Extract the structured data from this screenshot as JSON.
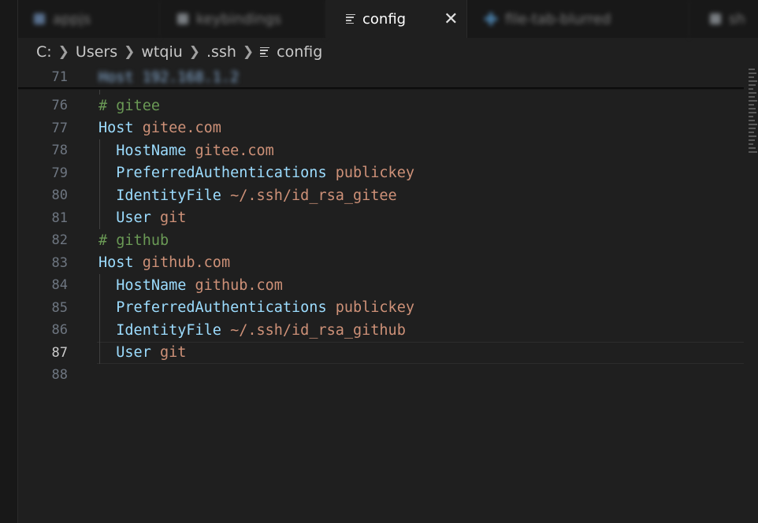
{
  "tabs": [
    {
      "label": "appjs",
      "blurred": true
    },
    {
      "label": "keybindings",
      "blurred": true
    },
    {
      "label": "config",
      "active": true
    },
    {
      "label": "file-tab-blurred",
      "blurred": true
    },
    {
      "label": "sh",
      "blurred": true
    }
  ],
  "breadcrumb": {
    "items": [
      "C:",
      "Users",
      "wtqiu",
      ".ssh"
    ],
    "file": "config"
  },
  "sticky": {
    "line_no": "71",
    "text": "Host 192.168.1.2"
  },
  "lines": [
    {
      "no": "76",
      "tokens": [
        {
          "t": "# gitee",
          "c": "c"
        }
      ]
    },
    {
      "no": "77",
      "tokens": [
        {
          "t": "Host",
          "c": "h"
        },
        {
          "t": " gitee.com",
          "c": "v"
        }
      ]
    },
    {
      "no": "78",
      "tokens": [
        {
          "t": "  HostName",
          "c": "k"
        },
        {
          "t": " gitee.com",
          "c": "v"
        }
      ]
    },
    {
      "no": "79",
      "tokens": [
        {
          "t": "  PreferredAuthentications",
          "c": "k"
        },
        {
          "t": " publickey",
          "c": "v"
        }
      ]
    },
    {
      "no": "80",
      "tokens": [
        {
          "t": "  IdentityFile",
          "c": "k"
        },
        {
          "t": " ~/.ssh/id_rsa_gitee",
          "c": "v"
        }
      ]
    },
    {
      "no": "81",
      "tokens": [
        {
          "t": "  User",
          "c": "k"
        },
        {
          "t": " git",
          "c": "v"
        }
      ]
    },
    {
      "no": "82",
      "tokens": [
        {
          "t": "# github",
          "c": "c"
        }
      ]
    },
    {
      "no": "83",
      "tokens": [
        {
          "t": "Host",
          "c": "h"
        },
        {
          "t": " github.com",
          "c": "v"
        }
      ]
    },
    {
      "no": "84",
      "tokens": [
        {
          "t": "  HostName",
          "c": "k"
        },
        {
          "t": " github.com",
          "c": "v"
        }
      ]
    },
    {
      "no": "85",
      "tokens": [
        {
          "t": "  PreferredAuthentications",
          "c": "k"
        },
        {
          "t": " publickey",
          "c": "v"
        }
      ]
    },
    {
      "no": "86",
      "tokens": [
        {
          "t": "  IdentityFile",
          "c": "k"
        },
        {
          "t": " ~/.ssh/id_rsa_github",
          "c": "v"
        }
      ]
    },
    {
      "no": "87",
      "tokens": [
        {
          "t": "  User",
          "c": "k"
        },
        {
          "t": " git",
          "c": "v"
        }
      ],
      "current": true
    },
    {
      "no": "88",
      "tokens": []
    }
  ]
}
